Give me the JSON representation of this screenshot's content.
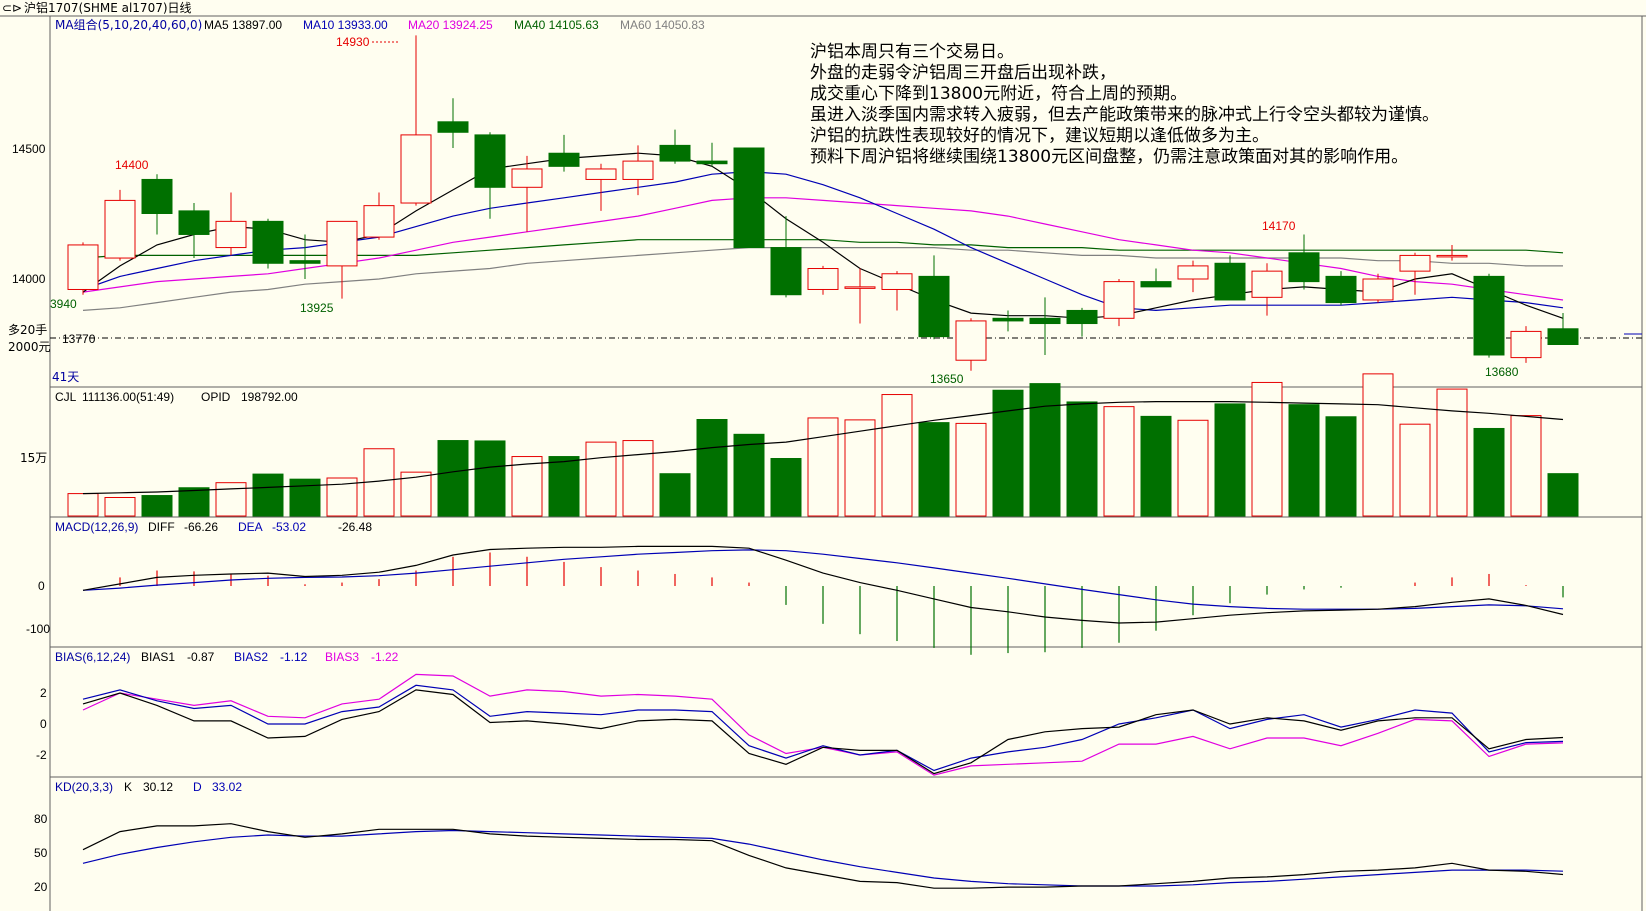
{
  "window": {
    "title": "沪铝1707(SHME al1707)日线",
    "icon": "chart-window-icon"
  },
  "colors": {
    "bg": "#fffef0",
    "up": "#e60000",
    "down": "#007000",
    "ma5": "#000000",
    "ma10": "#0000b4",
    "ma20": "#e000e0",
    "ma40": "#006000",
    "ma60": "#808080",
    "text_label": "#0000a0"
  },
  "price_panel": {
    "ma_group": "MA组合(5,10,20,40,60,0)",
    "ma5": "MA5 13897.00",
    "ma10": "MA10 13933.00",
    "ma20": "MA20 13924.25",
    "ma40": "MA40 14105.63",
    "ma60": "MA60 14050.83",
    "yticks": [
      "14500",
      "14000"
    ],
    "annotations": {
      "high_1": "14930",
      "high_2": "14400",
      "low_1": "13925",
      "low_2": "13650",
      "high_3": "14170",
      "low_3": "13680",
      "left_edge": "3940",
      "ref_line": "13770"
    },
    "position_1": "多20手",
    "position_2": "2000元",
    "days": "41天",
    "commentary": [
      "沪铝本周只有三个交易日。",
      "外盘的走弱令沪铝周三开盘后出现补跌，",
      "成交重心下降到13800元附近，符合上周的预期。",
      "虽进入淡季国内需求转入疲弱，但去产能政策带来的脉冲式上行令空头都较为谨慎。",
      "沪铝的抗跌性表现较好的情况下，建议短期以逢低做多为主。",
      "预料下周沪铝将继续围绕13800元区间盘整，仍需注意政策面对其的影响作用。"
    ]
  },
  "volume_panel": {
    "label": "CJL",
    "value": "111136.00(51:49)",
    "opid": "OPID",
    "opid_value": "198792.00",
    "ytick": "15万"
  },
  "macd_panel": {
    "label": "MACD(12,26,9)",
    "diff_label": "DIFF",
    "diff": "-66.26",
    "dea_label": "DEA",
    "dea": "-53.02",
    "macd": "-26.48",
    "yticks": [
      "0",
      "-100"
    ]
  },
  "bias_panel": {
    "label": "BIAS(6,12,24)",
    "bias1_label": "BIAS1",
    "bias1": "-0.87",
    "bias2_label": "BIAS2",
    "bias2": "-1.12",
    "bias3_label": "BIAS3",
    "bias3": "-1.22",
    "yticks": [
      "2",
      "0",
      "-2"
    ]
  },
  "kd_panel": {
    "label": "KD(20,3,3)",
    "k_label": "K",
    "k": "30.12",
    "d_label": "D",
    "d": "33.02",
    "yticks": [
      "80",
      "50",
      "20"
    ]
  },
  "chart_data": {
    "type": "candlestick",
    "title": "沪铝1707(SHME al1707)日线",
    "ylim": [
      13600,
      14950
    ],
    "candles": [
      {
        "o": 13960,
        "h": 14140,
        "l": 13940,
        "c": 14130
      },
      {
        "o": 14080,
        "h": 14340,
        "l": 14070,
        "c": 14300
      },
      {
        "o": 14380,
        "h": 14400,
        "l": 14170,
        "c": 14250
      },
      {
        "o": 14260,
        "h": 14290,
        "l": 14080,
        "c": 14170
      },
      {
        "o": 14120,
        "h": 14330,
        "l": 14090,
        "c": 14220
      },
      {
        "o": 14220,
        "h": 14230,
        "l": 14040,
        "c": 14060
      },
      {
        "o": 14070,
        "h": 14170,
        "l": 14000,
        "c": 14060
      },
      {
        "o": 14050,
        "h": 14210,
        "l": 13925,
        "c": 14220
      },
      {
        "o": 14160,
        "h": 14330,
        "l": 14150,
        "c": 14280
      },
      {
        "o": 14290,
        "h": 14930,
        "l": 14280,
        "c": 14550
      },
      {
        "o": 14600,
        "h": 14690,
        "l": 14500,
        "c": 14560
      },
      {
        "o": 14550,
        "h": 14560,
        "l": 14230,
        "c": 14350
      },
      {
        "o": 14350,
        "h": 14470,
        "l": 14180,
        "c": 14420
      },
      {
        "o": 14480,
        "h": 14550,
        "l": 14410,
        "c": 14430
      },
      {
        "o": 14380,
        "h": 14440,
        "l": 14260,
        "c": 14420
      },
      {
        "o": 14380,
        "h": 14510,
        "l": 14320,
        "c": 14450
      },
      {
        "o": 14510,
        "h": 14570,
        "l": 14440,
        "c": 14450
      },
      {
        "o": 14450,
        "h": 14520,
        "l": 14430,
        "c": 14440
      },
      {
        "o": 14500,
        "h": 14500,
        "l": 14120,
        "c": 14120
      },
      {
        "o": 14120,
        "h": 14240,
        "l": 13930,
        "c": 13940
      },
      {
        "o": 13960,
        "h": 14050,
        "l": 13940,
        "c": 14040
      },
      {
        "o": 13970,
        "h": 14040,
        "l": 13830,
        "c": 13970
      },
      {
        "o": 13960,
        "h": 14030,
        "l": 13880,
        "c": 14020
      },
      {
        "o": 14010,
        "h": 14090,
        "l": 13770,
        "c": 13780
      },
      {
        "o": 13690,
        "h": 13850,
        "l": 13650,
        "c": 13840
      },
      {
        "o": 13850,
        "h": 13880,
        "l": 13800,
        "c": 13840
      },
      {
        "o": 13850,
        "h": 13930,
        "l": 13710,
        "c": 13830
      },
      {
        "o": 13880,
        "h": 13890,
        "l": 13780,
        "c": 13830
      },
      {
        "o": 13850,
        "h": 14000,
        "l": 13820,
        "c": 13990
      },
      {
        "o": 13990,
        "h": 14040,
        "l": 13980,
        "c": 13970
      },
      {
        "o": 14000,
        "h": 14070,
        "l": 13950,
        "c": 14050
      },
      {
        "o": 14060,
        "h": 14090,
        "l": 13920,
        "c": 13920
      },
      {
        "o": 13930,
        "h": 14060,
        "l": 13860,
        "c": 14030
      },
      {
        "o": 14100,
        "h": 14170,
        "l": 13960,
        "c": 13990
      },
      {
        "o": 14010,
        "h": 14030,
        "l": 13900,
        "c": 13910
      },
      {
        "o": 13920,
        "h": 14020,
        "l": 13910,
        "c": 14000
      },
      {
        "o": 14030,
        "h": 14100,
        "l": 13940,
        "c": 14090
      },
      {
        "o": 14090,
        "h": 14130,
        "l": 14070,
        "c": 14090
      },
      {
        "o": 14010,
        "h": 14020,
        "l": 13700,
        "c": 13710
      },
      {
        "o": 13700,
        "h": 13820,
        "l": 13680,
        "c": 13800
      },
      {
        "o": 13810,
        "h": 13870,
        "l": 13800,
        "c": 13750
      }
    ],
    "ma5": [
      13950,
      14050,
      14130,
      14170,
      14200,
      14190,
      14150,
      14140,
      14170,
      14260,
      14340,
      14420,
      14440,
      14460,
      14470,
      14480,
      14470,
      14430,
      14340,
      14230,
      14140,
      14040,
      13980,
      13920,
      13870,
      13860,
      13860,
      13850,
      13860,
      13890,
      13920,
      13940,
      13960,
      13970,
      13960,
      13950,
      14000,
      14020,
      13960,
      13900,
      13850
    ],
    "ma10": [
      13960,
      14010,
      14040,
      14070,
      14090,
      14110,
      14120,
      14140,
      14160,
      14200,
      14240,
      14270,
      14290,
      14310,
      14330,
      14350,
      14370,
      14400,
      14410,
      14400,
      14360,
      14310,
      14250,
      14190,
      14120,
      14060,
      14000,
      13940,
      13890,
      13880,
      13890,
      13900,
      13900,
      13900,
      13900,
      13910,
      13920,
      13930,
      13920,
      13910,
      13890
    ],
    "ma20": [
      13950,
      13970,
      13990,
      14000,
      14010,
      14020,
      14040,
      14060,
      14080,
      14110,
      14140,
      14160,
      14180,
      14200,
      14220,
      14240,
      14270,
      14300,
      14310,
      14310,
      14300,
      14290,
      14280,
      14270,
      14260,
      14240,
      14210,
      14180,
      14150,
      14130,
      14110,
      14100,
      14080,
      14060,
      14040,
      14010,
      13990,
      13980,
      13960,
      13940,
      13920
    ],
    "ma40": [
      14080,
      14090,
      14090,
      14090,
      14090,
      14090,
      14090,
      14090,
      14090,
      14090,
      14100,
      14110,
      14120,
      14130,
      14140,
      14150,
      14150,
      14150,
      14150,
      14150,
      14150,
      14140,
      14140,
      14130,
      14130,
      14120,
      14120,
      14120,
      14110,
      14110,
      14110,
      14110,
      14110,
      14110,
      14110,
      14110,
      14110,
      14110,
      14110,
      14110,
      14100
    ],
    "ma60": [
      13880,
      13890,
      13910,
      13930,
      13950,
      13960,
      13980,
      13990,
      14000,
      14020,
      14030,
      14040,
      14060,
      14070,
      14080,
      14090,
      14100,
      14110,
      14120,
      14120,
      14120,
      14120,
      14120,
      14120,
      14110,
      14110,
      14100,
      14090,
      14090,
      14080,
      14080,
      14080,
      14080,
      14080,
      14080,
      14070,
      14070,
      14060,
      14060,
      14050,
      14050
    ],
    "volume": [
      60000,
      50000,
      55000,
      75000,
      88000,
      110000,
      97000,
      100000,
      175000,
      115000,
      196000,
      195000,
      155000,
      155000,
      192000,
      196000,
      111000,
      250000,
      212000,
      150000,
      254000,
      249000,
      314000,
      242000,
      240000,
      325000,
      342000,
      295000,
      283000,
      258000,
      248000,
      290000,
      345000,
      288000,
      257000,
      367000,
      238000,
      328000,
      227000,
      260000,
      111136
    ],
    "volume_ma": [
      60000,
      62000,
      64000,
      68000,
      72000,
      76000,
      80000,
      84000,
      92000,
      102000,
      116000,
      128000,
      136000,
      142000,
      152000,
      160000,
      168000,
      178000,
      186000,
      192000,
      206000,
      220000,
      234000,
      248000,
      260000,
      272000,
      284000,
      290000,
      294000,
      296000,
      296000,
      296000,
      294000,
      292000,
      290000,
      288000,
      280000,
      272000,
      266000,
      258000,
      250000
    ],
    "macd_diff": [
      -10,
      5,
      20,
      25,
      28,
      30,
      22,
      25,
      32,
      48,
      72,
      85,
      88,
      90,
      90,
      92,
      92,
      92,
      88,
      60,
      30,
      8,
      -10,
      -30,
      -50,
      -60,
      -72,
      -80,
      -86,
      -84,
      -76,
      -68,
      -62,
      -58,
      -56,
      -54,
      -48,
      -38,
      -30,
      -45,
      -66.26
    ],
    "macd_dea": [
      -10,
      -5,
      2,
      8,
      14,
      18,
      20,
      21,
      24,
      30,
      38,
      46,
      54,
      62,
      68,
      74,
      78,
      82,
      84,
      82,
      74,
      64,
      54,
      42,
      30,
      18,
      5,
      -8,
      -20,
      -32,
      -42,
      -48,
      -52,
      -54,
      -54,
      -54,
      -52,
      -48,
      -44,
      -46,
      -53.02
    ],
    "macd_hist": [
      0,
      20,
      36,
      34,
      28,
      24,
      4,
      8,
      16,
      36,
      68,
      78,
      68,
      56,
      44,
      36,
      28,
      20,
      8,
      -44,
      -88,
      -112,
      -128,
      -144,
      -160,
      -156,
      -154,
      -144,
      -132,
      -104,
      -68,
      -40,
      -20,
      -8,
      -4,
      0,
      8,
      20,
      28,
      2,
      -26.48
    ],
    "bias1": [
      1.3,
      2.0,
      1.2,
      0.2,
      0.2,
      -0.9,
      -0.8,
      0.3,
      0.8,
      2.2,
      1.9,
      0.1,
      0.2,
      0,
      -0.3,
      0.2,
      0.3,
      0.2,
      -1.9,
      -2.6,
      -1.5,
      -1.7,
      -1.7,
      -3.2,
      -2.5,
      -1.0,
      -0.5,
      -0.3,
      -0.2,
      0.6,
      0.9,
      0,
      0.4,
      0.2,
      -0.4,
      0.2,
      0.4,
      0.4,
      -1.6,
      -1.0,
      -0.87
    ],
    "bias2": [
      1.6,
      2.2,
      1.5,
      1.0,
      1.2,
      0,
      0,
      0.8,
      1.1,
      2.5,
      2.2,
      0.5,
      0.8,
      0.7,
      0.6,
      0.9,
      0.9,
      0.8,
      -1.4,
      -2.2,
      -1.4,
      -2.0,
      -1.7,
      -3.0,
      -2.2,
      -1.8,
      -1.5,
      -1.0,
      0,
      0.4,
      0.9,
      -0.3,
      0.3,
      0.6,
      -0.2,
      0.3,
      0.9,
      0.7,
      -1.8,
      -1.2,
      -1.12
    ],
    "bias3": [
      0.9,
      2.0,
      1.6,
      1.2,
      1.5,
      0.5,
      0.4,
      1.3,
      1.6,
      3.2,
      3.1,
      1.8,
      2.2,
      2.1,
      1.8,
      1.9,
      1.8,
      1.6,
      -0.7,
      -1.9,
      -1.5,
      -2.0,
      -1.8,
      -3.3,
      -2.7,
      -2.6,
      -2.5,
      -2.4,
      -1.3,
      -1.3,
      -0.8,
      -1.6,
      -0.9,
      -0.9,
      -1.4,
      -0.6,
      0.3,
      0.2,
      -2.1,
      -1.3,
      -1.22
    ],
    "kd_k": [
      52,
      68,
      73,
      73,
      75,
      68,
      63,
      66,
      70,
      70,
      70,
      66,
      64,
      63,
      62,
      61,
      61,
      60,
      47,
      36,
      30,
      24,
      23,
      18,
      18,
      19,
      19,
      20,
      20,
      22,
      24,
      27,
      28,
      30,
      33,
      34,
      36,
      40,
      34,
      33,
      30.12
    ],
    "kd_d": [
      40,
      48,
      54,
      59,
      63,
      65,
      64,
      64,
      66,
      68,
      69,
      68,
      67,
      66,
      65,
      64,
      63,
      62,
      57,
      50,
      43,
      37,
      32,
      27,
      24,
      22,
      21,
      20,
      20,
      20,
      21,
      23,
      24,
      26,
      28,
      30,
      32,
      34,
      34,
      34,
      33.02
    ]
  }
}
